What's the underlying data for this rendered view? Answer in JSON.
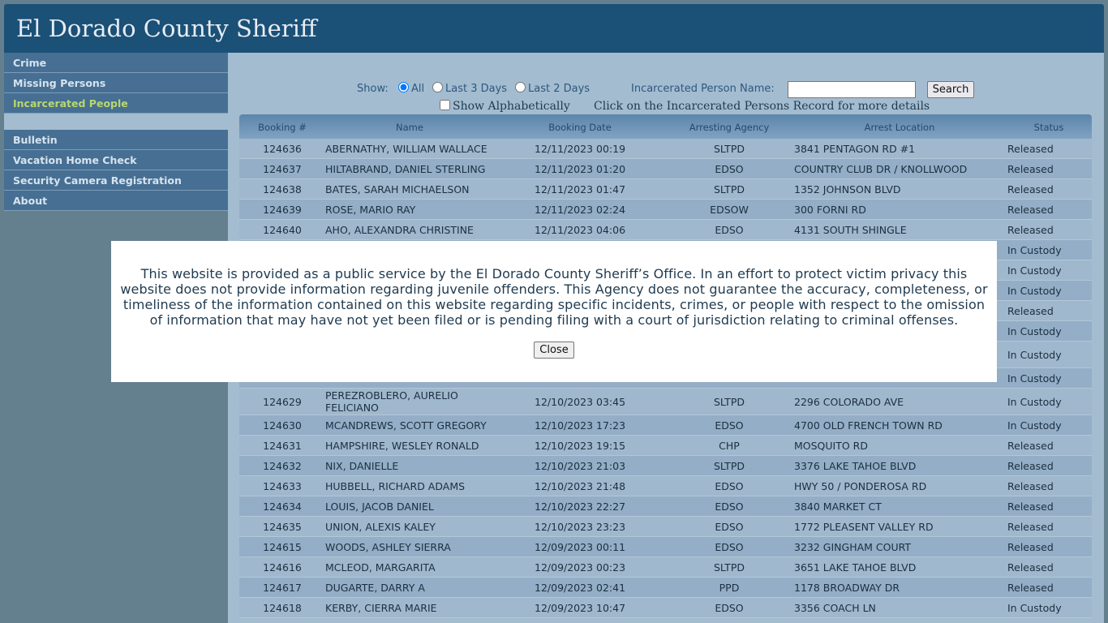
{
  "header": {
    "title": "El Dorado County Sheriff"
  },
  "sidebar": {
    "top_items": [
      {
        "label": "Crime"
      },
      {
        "label": "Missing Persons"
      },
      {
        "label": "Incarcerated People",
        "active": true
      }
    ],
    "bottom_items": [
      {
        "label": "Bulletin"
      },
      {
        "label": "Vacation Home Check"
      },
      {
        "label": "Security Camera Registration"
      },
      {
        "label": "About"
      }
    ]
  },
  "controls": {
    "show_label": "Show:",
    "options": [
      {
        "label": "All",
        "checked": true
      },
      {
        "label": "Last 3 Days",
        "checked": false
      },
      {
        "label": "Last 2 Days",
        "checked": false
      }
    ],
    "name_label": "Incarcerated Person Name:",
    "name_value": "",
    "search_label": "Search",
    "alpha_label": "Show Alphabetically",
    "alpha_checked": false,
    "hint": "Click on the Incarcerated Persons Record for more details"
  },
  "table": {
    "columns": [
      "Booking #",
      "Name",
      "Booking Date",
      "Arresting Agency",
      "Arrest Location",
      "Status"
    ],
    "rows": [
      {
        "booking": "124636",
        "name": "ABERNATHY, WILLIAM WALLACE",
        "date": "12/11/2023 00:19",
        "agency": "SLTPD",
        "location": "3841 PENTAGON RD #1",
        "status": "Released"
      },
      {
        "booking": "124637",
        "name": "HILTABRAND, DANIEL STERLING",
        "date": "12/11/2023 01:20",
        "agency": "EDSO",
        "location": "COUNTRY CLUB DR / KNOLLWOOD",
        "status": "Released"
      },
      {
        "booking": "124638",
        "name": "BATES, SARAH MICHAELSON",
        "date": "12/11/2023 01:47",
        "agency": "SLTPD",
        "location": "1352 JOHNSON BLVD",
        "status": "Released"
      },
      {
        "booking": "124639",
        "name": "ROSE, MARIO RAY",
        "date": "12/11/2023 02:24",
        "agency": "EDSOW",
        "location": "300 FORNI RD",
        "status": "Released"
      },
      {
        "booking": "124640",
        "name": "AHO, ALEXANDRA CHRISTINE",
        "date": "12/11/2023 04:06",
        "agency": "EDSO",
        "location": "4131 SOUTH SHINGLE",
        "status": "Released"
      },
      {
        "booking": "",
        "name": "",
        "date": "",
        "agency": "",
        "location": "",
        "status": "In Custody"
      },
      {
        "booking": "",
        "name": "",
        "date": "",
        "agency": "",
        "location": "",
        "status": "In Custody"
      },
      {
        "booking": "",
        "name": "",
        "date": "",
        "agency": "",
        "location": "",
        "status": "In Custody"
      },
      {
        "booking": "",
        "name": "",
        "date": "",
        "agency": "",
        "location": "",
        "status": "Released"
      },
      {
        "booking": "",
        "name": "",
        "date": "",
        "agency": "",
        "location": "",
        "status": "In Custody"
      },
      {
        "booking": "",
        "name": "",
        "date": "",
        "agency": "",
        "location": "",
        "status": "In Custody",
        "tall": true
      },
      {
        "booking": "",
        "name": "",
        "date": "",
        "agency": "",
        "location": "",
        "status": "In Custody"
      },
      {
        "booking": "124629",
        "name": "PEREZROBLERO, AURELIO FELICIANO",
        "date": "12/10/2023 03:45",
        "agency": "SLTPD",
        "location": "2296 COLORADO AVE",
        "status": "In Custody",
        "tall": true
      },
      {
        "booking": "124630",
        "name": "MCANDREWS, SCOTT GREGORY",
        "date": "12/10/2023 17:23",
        "agency": "EDSO",
        "location": "4700 OLD FRENCH TOWN RD",
        "status": "In Custody"
      },
      {
        "booking": "124631",
        "name": "HAMPSHIRE, WESLEY RONALD",
        "date": "12/10/2023 19:15",
        "agency": "CHP",
        "location": "MOSQUITO RD",
        "status": "Released"
      },
      {
        "booking": "124632",
        "name": "NIX, DANIELLE",
        "date": "12/10/2023 21:03",
        "agency": "SLTPD",
        "location": "3376 LAKE TAHOE BLVD",
        "status": "Released"
      },
      {
        "booking": "124633",
        "name": "HUBBELL, RICHARD ADAMS",
        "date": "12/10/2023 21:48",
        "agency": "EDSO",
        "location": "HWY 50 / PONDEROSA RD",
        "status": "Released"
      },
      {
        "booking": "124634",
        "name": "LOUIS, JACOB DANIEL",
        "date": "12/10/2023 22:27",
        "agency": "EDSO",
        "location": "3840 MARKET CT",
        "status": "Released"
      },
      {
        "booking": "124635",
        "name": "UNION, ALEXIS KALEY",
        "date": "12/10/2023 23:23",
        "agency": "EDSO",
        "location": "1772 PLEASENT VALLEY RD",
        "status": "Released"
      },
      {
        "booking": "124615",
        "name": "WOODS, ASHLEY SIERRA",
        "date": "12/09/2023 00:11",
        "agency": "EDSO",
        "location": "3232 GINGHAM COURT",
        "status": "Released"
      },
      {
        "booking": "124616",
        "name": "MCLEOD, MARGARITA",
        "date": "12/09/2023 00:23",
        "agency": "SLTPD",
        "location": "3651 LAKE TAHOE BLVD",
        "status": "Released"
      },
      {
        "booking": "124617",
        "name": "DUGARTE, DARRY A",
        "date": "12/09/2023 02:41",
        "agency": "PPD",
        "location": "1178 BROADWAY DR",
        "status": "Released"
      },
      {
        "booking": "124618",
        "name": "KERBY, CIERRA MARIE",
        "date": "12/09/2023 10:47",
        "agency": "EDSO",
        "location": "3356 COACH LN",
        "status": "In Custody"
      }
    ]
  },
  "modal": {
    "message": "This website is provided as a public service by the El Dorado County Sheriff’s Office. In an effort to protect victim privacy this website does not provide information regarding juvenile offenders. This Agency does not guarantee the accuracy, completeness, or timeliness of the information contained on this website regarding specific incidents, crimes, or people with respect to the omission of information that may have not yet been filed or is pending filing with a court of jurisdiction relating to criminal offenses.",
    "close_label": "Close"
  }
}
